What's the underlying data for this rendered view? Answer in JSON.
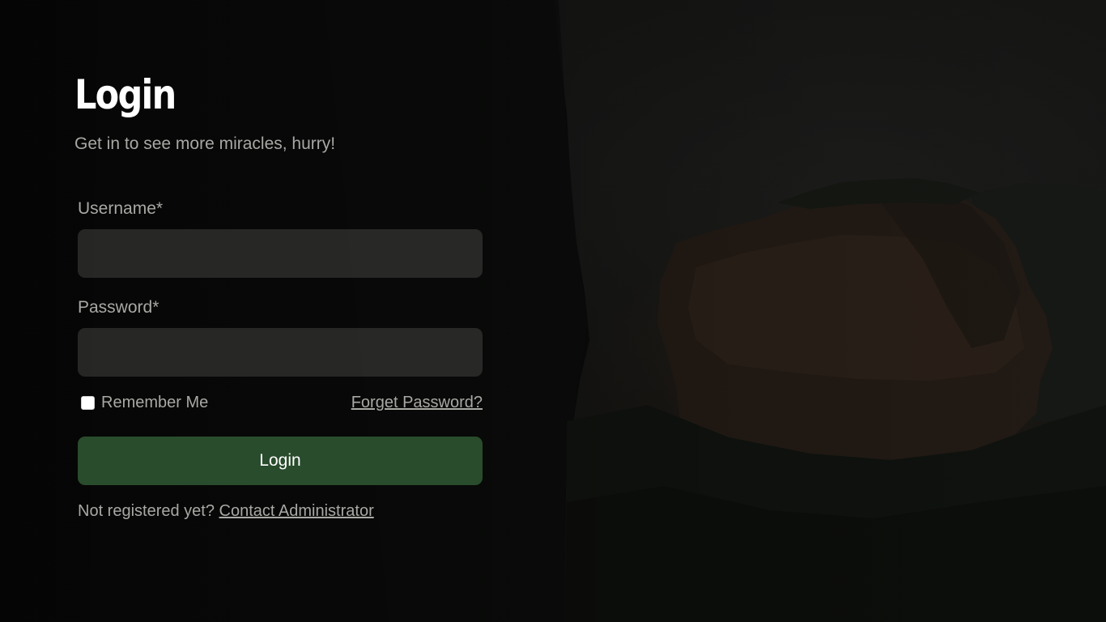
{
  "login": {
    "title": "Login",
    "subtitle": "Get in to see more miracles, hurry!",
    "username": {
      "label": "Username",
      "required_mark": "*",
      "value": "",
      "placeholder": ""
    },
    "password": {
      "label": "Password",
      "required_mark": "*",
      "value": "",
      "placeholder": ""
    },
    "remember_me": {
      "label": "Remember Me",
      "checked": false
    },
    "forgot_password_link": "Forget Password?",
    "submit_label": "Login",
    "register_prompt": "Not registered yet?",
    "contact_admin_link": "Contact Administrator"
  },
  "colors": {
    "button_bg": "#294c2c",
    "input_bg": "#3c3c3a",
    "muted_text": "#a8a8a4",
    "title_text": "#ffffff"
  }
}
